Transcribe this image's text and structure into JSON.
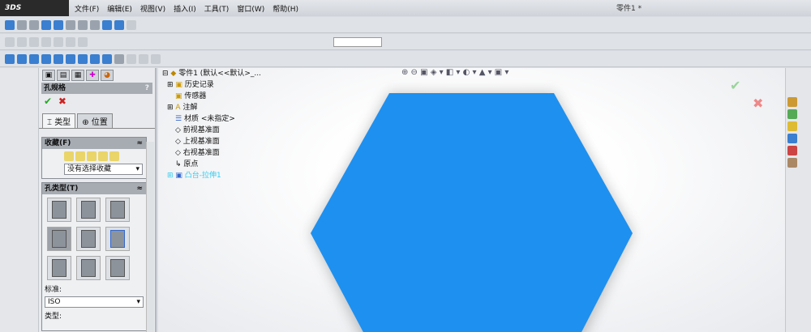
{
  "app": {
    "logo": "3DS SOLIDWORKS",
    "document_title": "零件1 *"
  },
  "menu": [
    "文件(F)",
    "编辑(E)",
    "视图(V)",
    "插入(I)",
    "工具(T)",
    "窗口(W)",
    "帮助(H)"
  ],
  "panel": {
    "title": "孔规格",
    "help": "?",
    "ok": "✔",
    "cancel": "✖",
    "tabs": [
      {
        "label": "类型"
      },
      {
        "label": "位置"
      }
    ],
    "favorites": {
      "header": "收藏(F)",
      "select_value": "没有选择收藏"
    },
    "hole_type": {
      "header": "孔类型(T)",
      "standard_label": "标准:",
      "standard_value": "ISO",
      "type_label": "类型:"
    }
  },
  "tree": {
    "root": "零件1 (默认<<默认>_...",
    "items": [
      "历史记录",
      "传感器",
      "注解",
      "材质 <未指定>",
      "前视基准面",
      "上视基准面",
      "右视基准面",
      "原点",
      "凸台-拉伸1"
    ]
  },
  "colors": {
    "part": "#1e90f0",
    "highlight": "#33ccee"
  }
}
